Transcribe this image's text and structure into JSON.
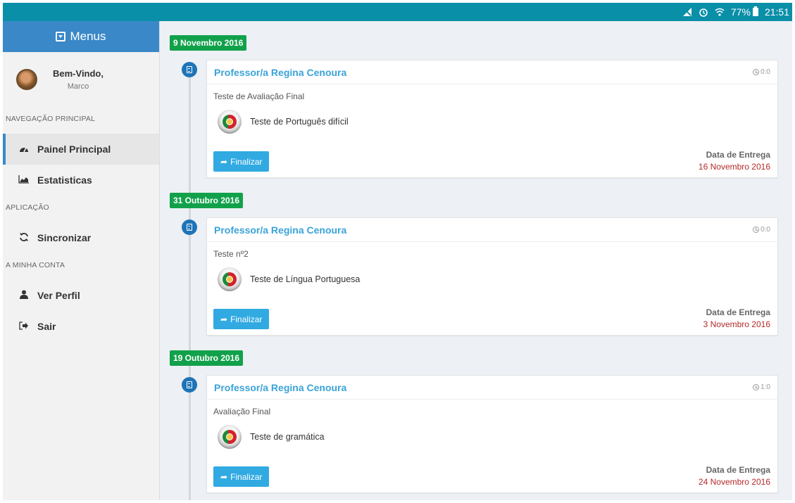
{
  "status_bar": {
    "signal_icon": "no-signal-icon",
    "alarm_icon": "alarm-icon",
    "wifi_icon": "wifi-icon",
    "battery": "77%",
    "time": "21:51"
  },
  "sidebar": {
    "header": "Menus",
    "user": {
      "welcome": "Bem-Vindo,",
      "name": "Marco"
    },
    "sections": [
      {
        "title": "NAVEGAÇÃO PRINCIPAL"
      },
      {
        "title": "APLICAÇÃO"
      },
      {
        "title": "A MINHA CONTA"
      }
    ],
    "items": [
      {
        "label": "Painel Principal",
        "icon": "dashboard-icon"
      },
      {
        "label": "Estatisticas",
        "icon": "area-chart-icon"
      },
      {
        "label": "Sincronizar",
        "icon": "refresh-icon"
      },
      {
        "label": "Ver Perfil",
        "icon": "user-icon"
      },
      {
        "label": "Sair",
        "icon": "sign-out-icon"
      }
    ]
  },
  "timeline": [
    {
      "date": "9 Novembro 2016",
      "teacher": "Professor/a Regina Cenoura",
      "time": "0:0",
      "type": "Teste de Avaliação Final",
      "test": "Teste de Português difícil",
      "button": "Finalizar",
      "delivery_label": "Data de Entrega",
      "delivery_date": "16 Novembro 2016"
    },
    {
      "date": "31 Outubro 2016",
      "teacher": "Professor/a Regina Cenoura",
      "time": "0:0",
      "type": "Teste nº2",
      "test": "Teste de Língua Portuguesa",
      "button": "Finalizar",
      "delivery_label": "Data de Entrega",
      "delivery_date": "3 Novembro 2016"
    },
    {
      "date": "19 Outubro 2016",
      "teacher": "Professor/a Regina Cenoura",
      "time": "1:0",
      "type": "Avaliação Final",
      "test": "Teste de gramática",
      "button": "Finalizar",
      "delivery_label": "Data de Entrega",
      "delivery_date": "24 Novembro 2016"
    }
  ],
  "colors": {
    "status_bar": "#0a8fa8",
    "sidebar_header": "#3a88c8",
    "date_tag": "#12a14b",
    "teacher_link": "#3aa3d8",
    "button": "#31aae2",
    "delivery_date": "#b52a2a"
  }
}
